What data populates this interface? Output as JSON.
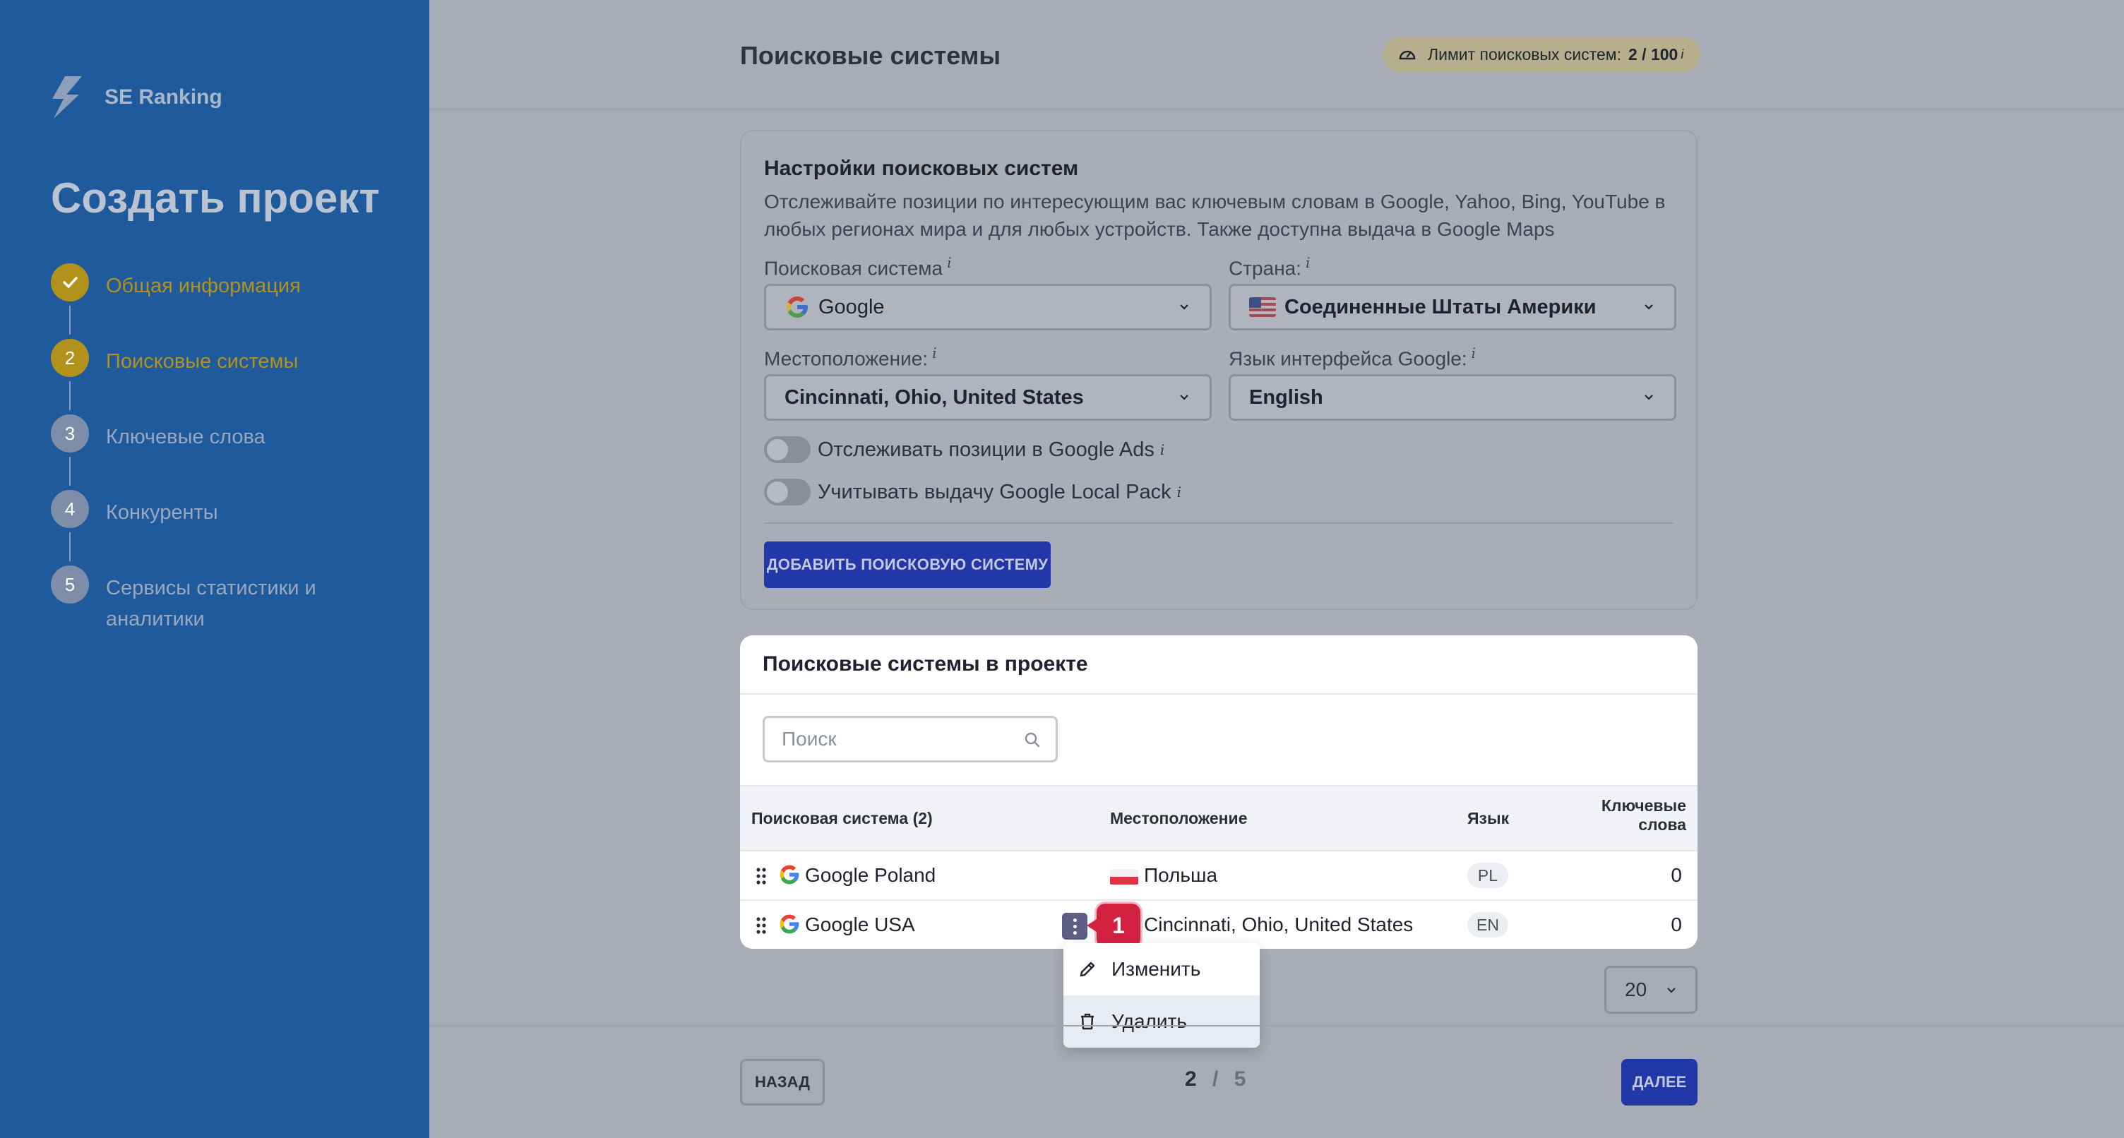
{
  "brand": {
    "name": "SE Ranking"
  },
  "sidebar": {
    "title": "Создать проект",
    "steps": [
      {
        "number": "✓",
        "label": "Общая информация",
        "state": "done"
      },
      {
        "number": "2",
        "label": "Поисковые системы",
        "state": "active"
      },
      {
        "number": "3",
        "label": "Ключевые слова",
        "state": "pending"
      },
      {
        "number": "4",
        "label": "Конкуренты",
        "state": "pending"
      },
      {
        "number": "5",
        "label": "Сервисы статистики и аналитики",
        "state": "pending"
      }
    ]
  },
  "header": {
    "title": "Поисковые системы",
    "limit_label": "Лимит поисковых систем:",
    "limit_value": "2 / 100",
    "info_mark": "i"
  },
  "settings": {
    "title": "Настройки поисковых систем",
    "description": "Отслеживайте позиции по интересующим вас ключевым словам в Google, Yahoo, Bing, YouTube в любых регионах мира и для любых устройств. Также доступна выдача в Google Maps",
    "engine_label": "Поисковая система",
    "engine_value": "Google",
    "country_label": "Страна:",
    "country_value": "Соединенные Штаты Америки",
    "location_label": "Местоположение:",
    "location_value": "Cincinnati, Ohio, United States",
    "language_label": "Язык интерфейса Google:",
    "language_value": "English",
    "toggle_ads_label": "Отслеживать позиции в Google Ads",
    "toggle_ads_on": false,
    "toggle_local_label": "Учитывать выдачу Google Local Pack",
    "toggle_local_on": false,
    "add_button": "ДОБАВИТЬ ПОИСКОВУЮ СИСТЕМУ",
    "info_mark": "i"
  },
  "engines": {
    "title": "Поисковые системы в проекте",
    "search_placeholder": "Поиск",
    "columns": {
      "engine": "Поисковая система (2)",
      "location": "Местоположение",
      "language": "Язык",
      "keywords_line1": "Ключевые",
      "keywords_line2": "слова"
    },
    "rows": [
      {
        "name": "Google Poland",
        "location": "Польша",
        "language": "PL",
        "keywords": "0"
      },
      {
        "name": "Google USA",
        "location": "Cincinnati, Ohio, United States",
        "language": "EN",
        "keywords": "0"
      }
    ],
    "marker": "1",
    "menu": {
      "edit": "Изменить",
      "delete": "Удалить"
    }
  },
  "pagination": {
    "per_page": "20",
    "current": "2",
    "separator": "/",
    "total": "5"
  },
  "footer": {
    "back": "НАЗАД",
    "next": "ДАЛЕЕ"
  },
  "colors": {
    "sidebar": "#1f5a9c",
    "accent_gold": "#b3921c",
    "primary": "#2238a8",
    "marker": "#d32140"
  }
}
